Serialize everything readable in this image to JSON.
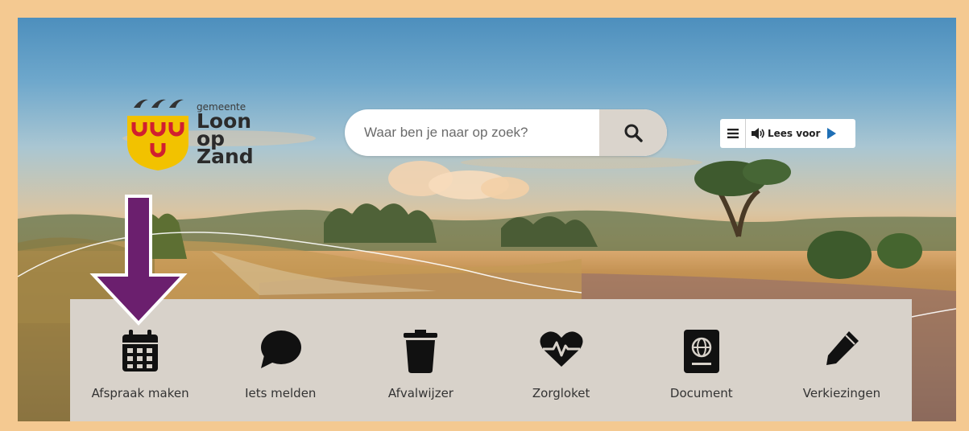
{
  "logo": {
    "small_text": "gemeente",
    "line1": "Loon",
    "line2": "op Zand"
  },
  "search": {
    "placeholder": "Waar ben je naar op zoek?",
    "button_icon": "search-icon"
  },
  "read_aloud": {
    "menu_icon": "hamburger-menu-icon",
    "speaker_icon": "speaker-icon",
    "label": "Lees voor",
    "play_icon": "play-icon"
  },
  "services": [
    {
      "label": "Afspraak maken",
      "icon": "calendar-icon"
    },
    {
      "label": "Iets melden",
      "icon": "speech-bubble-icon"
    },
    {
      "label": "Afvalwijzer",
      "icon": "trash-icon"
    },
    {
      "label": "Zorgloket",
      "icon": "heartbeat-icon"
    },
    {
      "label": "Document",
      "icon": "passport-icon"
    },
    {
      "label": "Verkiezingen",
      "icon": "pencil-icon"
    }
  ],
  "colors": {
    "frame_border": "#f4c991",
    "arrow": "#6b1f6e",
    "panel": "#d8d2ca",
    "logo_yellow": "#f2c200",
    "logo_red": "#d11f2f"
  }
}
